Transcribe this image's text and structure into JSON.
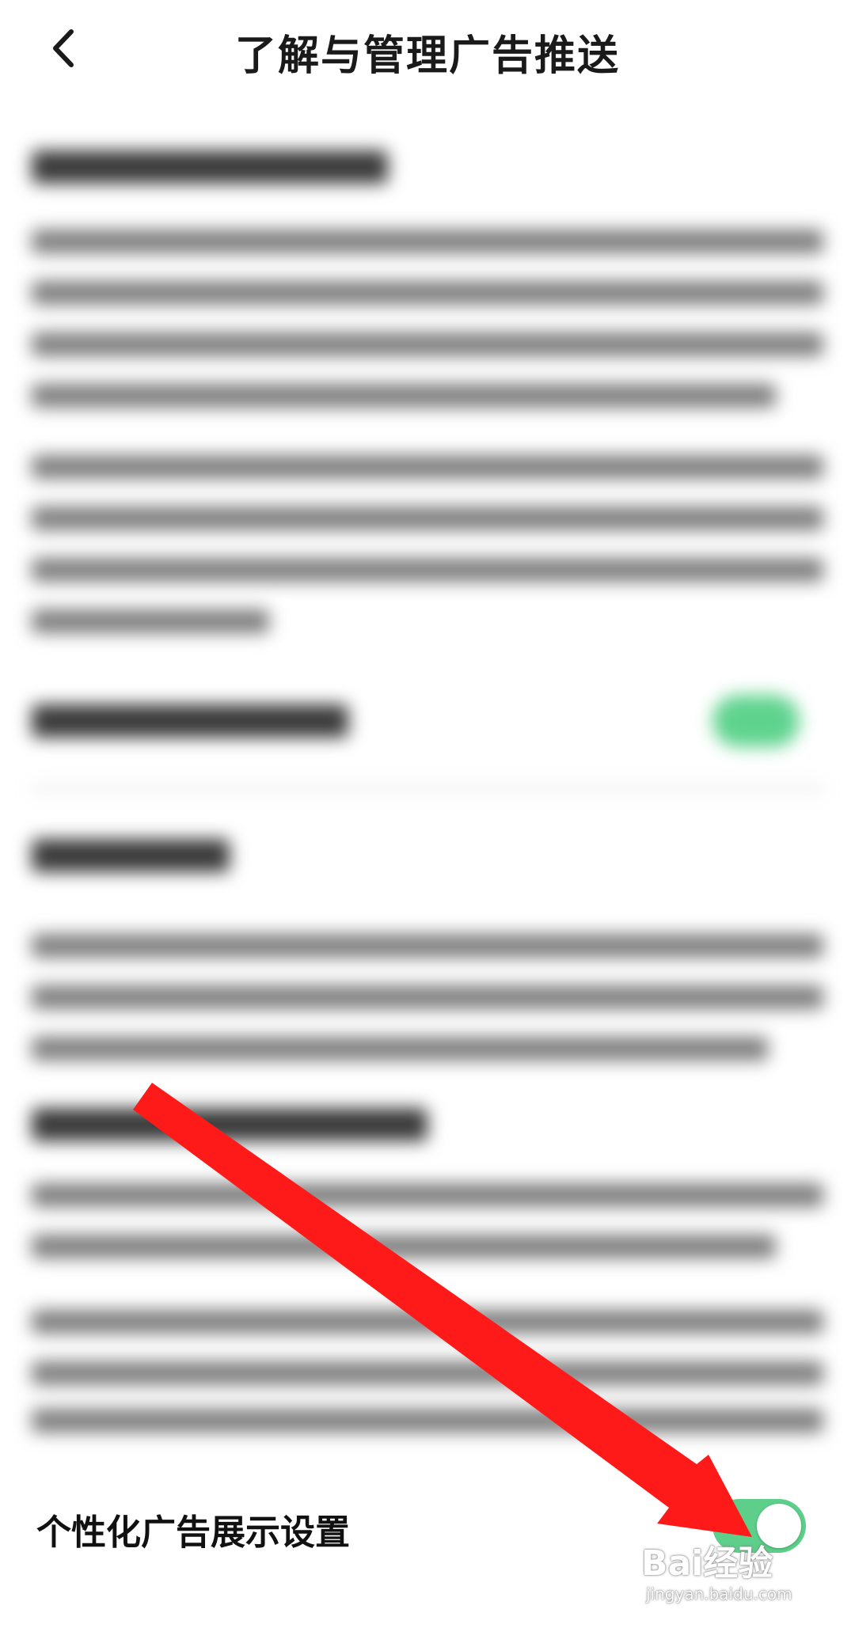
{
  "header": {
    "title": "了解与管理广告推送",
    "back_icon": "chevron-left-icon"
  },
  "setting": {
    "label": "个性化广告展示设置",
    "toggle_on": true,
    "toggle_color": "#5dcf8a"
  },
  "annotation": {
    "arrow_color": "#ff1a1a"
  },
  "watermark": {
    "main": "Bai经验",
    "sub": "jingyan.baidu.com"
  }
}
